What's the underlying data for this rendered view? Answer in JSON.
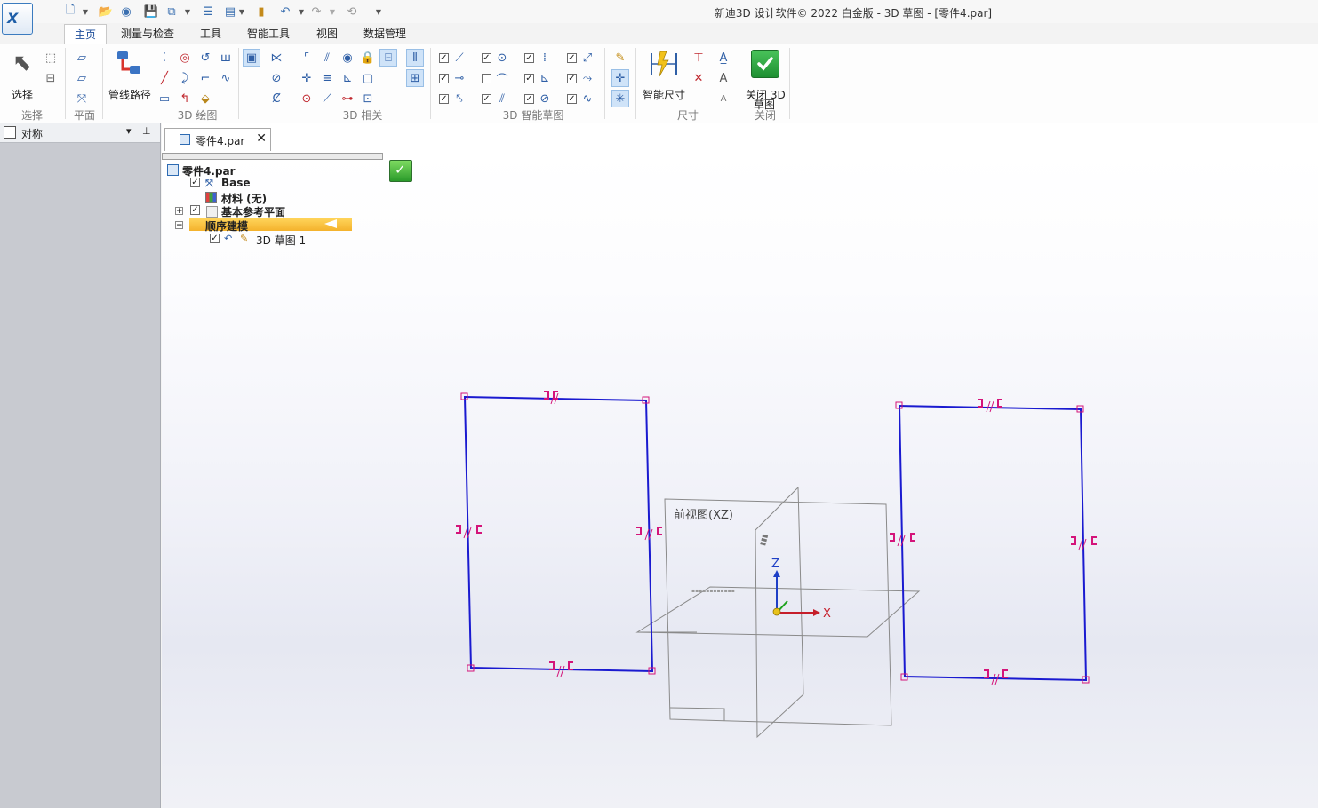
{
  "window": {
    "title": "新迪3D 设计软件© 2022 白金版 - 3D 草图 - [零件4.par]",
    "logo_text": "X"
  },
  "tabs": [
    "主页",
    "测量与检查",
    "工具",
    "智能工具",
    "视图",
    "数据管理"
  ],
  "ribbon": {
    "select_label": "选择",
    "pipe_path_label": "管线路径",
    "smart_dim_label": "智能尺寸",
    "close_label": "关闭 3D",
    "close_label2": "草图",
    "groups": {
      "select": "选择",
      "plane": "平面",
      "draw3d": "3D 绘图",
      "relate3d": "3D 相关",
      "smartsketch": "3D 智能草图",
      "dimension": "尺寸",
      "close": "关闭"
    }
  },
  "left_panel": {
    "title": "对称"
  },
  "document": {
    "tab_name": "零件4.par",
    "close_symbol": "✕"
  },
  "tree": {
    "root": "零件4.par",
    "base": "Base",
    "material": "材料 (无)",
    "ref_planes": "基本参考平面",
    "sequential": "顺序建模",
    "sketch": "3D 草图 1"
  },
  "viewport": {
    "front_plane_label": "前视图(XZ)",
    "axis_x": "X",
    "axis_z": "Z"
  },
  "colors": {
    "sketch_line": "#1a1ad0",
    "relation_marker": "#d4147a",
    "accent": "#1f4f9b",
    "tree_highlight": "#f4b22c"
  }
}
